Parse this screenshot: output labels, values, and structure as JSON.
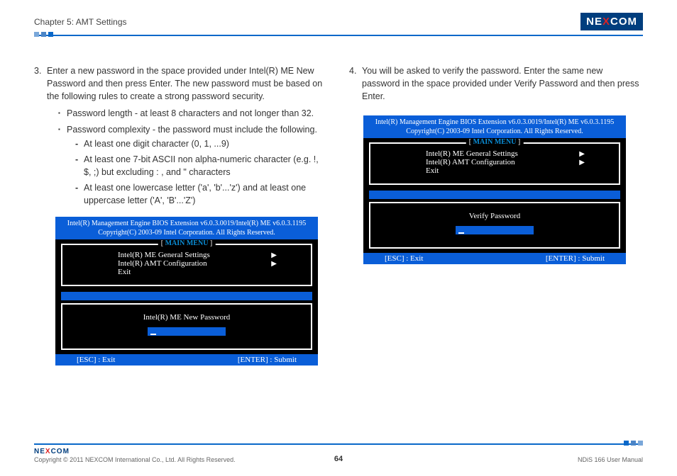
{
  "header": {
    "chapter": "Chapter 5: AMT Settings",
    "logo_pre": "NE",
    "logo_x": "X",
    "logo_post": "COM"
  },
  "left": {
    "step_num": "3.",
    "step_text": "Enter a new password in the space provided under Intel(R) ME New Password and then press Enter. The new password must be based on the following rules to create a strong password security.",
    "bul1": "Password length - at least 8 characters and not longer than 32.",
    "bul2": "Password complexity - the password must include the following.",
    "dash1": "At least one digit character (0, 1, ...9)",
    "dash2": "At least one 7-bit ASCII non alpha-numeric character (e.g. !, $, ;) but excluding : , and \" characters",
    "dash3": "At least one lowercase letter ('a', 'b'...'z') and at least one uppercase letter ('A', 'B'...'Z')"
  },
  "right": {
    "step_num": "4.",
    "step_text": "You will be asked to verify the password. Enter the same new password in the space provided under Verify Password and then press Enter."
  },
  "bios": {
    "header_l1": "Intel(R) Management Engine BIOS Extension v6.0.3.0019/Intel(R) ME v6.0.3.1195",
    "header_l2": "Copyright(C) 2003-09 Intel Corporation. All Rights Reserved.",
    "menu_title": "MAIN MENU",
    "menu1": "Intel(R) ME General Settings",
    "menu2": "Intel(R) AMT Configuration",
    "menu3": "Exit",
    "prompt_left": "Intel(R) ME New Password",
    "prompt_right": "Verify Password",
    "esc": "[ESC] : Exit",
    "enter": "[ENTER] : Submit"
  },
  "footer": {
    "logo_pre": "NE",
    "logo_x": "X",
    "logo_post": "COM",
    "copyright": "Copyright © 2011 NEXCOM International Co., Ltd. All Rights Reserved.",
    "page": "64",
    "manual": "NDiS 166 User Manual"
  }
}
